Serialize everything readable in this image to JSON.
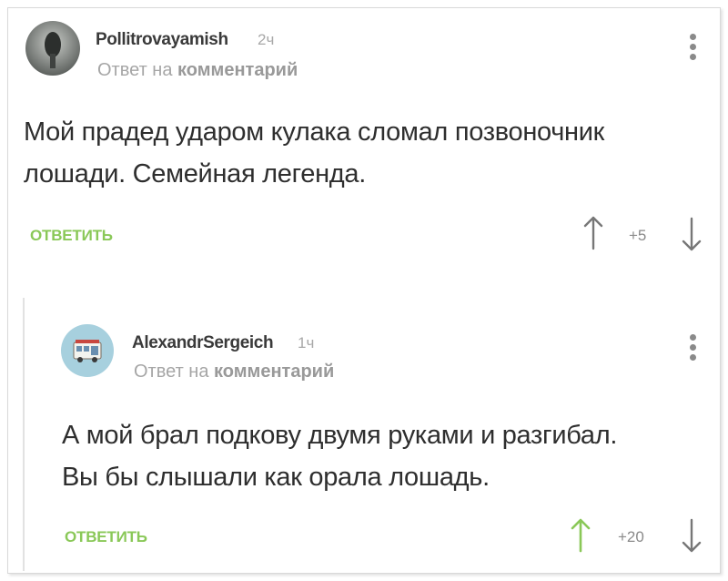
{
  "comments": [
    {
      "username": "Pollitrovayamish",
      "time": "2ч",
      "reply_prefix": "Ответ на",
      "reply_target": "комментарий",
      "text_line1": "Мой прадед ударом кулака сломал позвоночник",
      "text_line2": "лошади. Семейная легенда.",
      "reply_label": "ОТВЕТИТЬ",
      "score": "+5",
      "upvoted": false
    },
    {
      "username": "AlexandrSergeich",
      "time": "1ч",
      "reply_prefix": "Ответ на",
      "reply_target": "комментарий",
      "text_line1": "А мой брал подкову двумя руками и разгибал.",
      "text_line2": "Вы бы слышали как орала лошадь.",
      "reply_label": "ОТВЕТИТЬ",
      "score": "+20",
      "upvoted": true
    }
  ],
  "colors": {
    "accent_green": "#8ac858",
    "text_gray": "#a6a6a6",
    "arrow_gray": "#777777"
  },
  "icons": [
    "avatar-image",
    "more-vertical-icon",
    "arrow-up-icon",
    "arrow-down-icon"
  ]
}
